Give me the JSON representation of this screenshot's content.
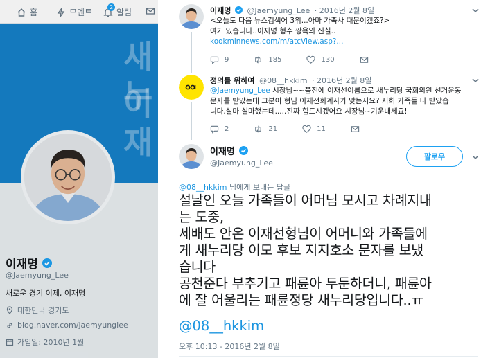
{
  "nav": {
    "home": "홈",
    "moments": "모멘트",
    "notifications": "알림",
    "notif_count": "2"
  },
  "banner": {
    "line1": "새누",
    "line2": "이재"
  },
  "profile": {
    "name": "이재명",
    "handle": "@Jaemyung_Lee",
    "bio": "새로운 경기 이제, 이재명",
    "location": "대한민국 경기도",
    "website": "blog.naver.com/jaemyunglee",
    "joined": "가입일: 2010년 1월"
  },
  "thread": [
    {
      "name": "이재명",
      "handle": "@Jaemyung_Lee",
      "time": "· 2016년 2월 8일",
      "lines": [
        "<오늘도 다음 뉴스검색어 3위...아마 가족사 때문이겠죠?>",
        "여기 있습니다..이재명 형수 쌍욕의 진실.."
      ],
      "link": "kookminnews.com/m/atcView.asp?...",
      "replies": "9",
      "retweets": "185",
      "likes": "130"
    },
    {
      "name": "정의를 위하여",
      "handle": "@08__hkkim",
      "time": "· 2016년 2월 8일",
      "mention": "@Jaemyung_Lee",
      "lines": [
        " 시장님~~쫌전에 이재선이름으로 새누리당 국회의원 선거운동",
        "문자를 받았는데 그분이 형님 이재선회계사가 맞는지요? 저희 가족들 다 받았습",
        "니다.설마 설마했는데.....진짜 힘드시겠어요 시장님~기운내세요!"
      ],
      "replies": "2",
      "retweets": "21",
      "likes": "11"
    }
  ],
  "main_tweet": {
    "name": "이재명",
    "handle": "@Jaemyung_Lee",
    "follow_label": "팔로우",
    "reply_to_mention": "@08__hkkim",
    "reply_to_suffix": " 님에게 보내는 답글",
    "text": "설날인 오늘 가족들이 어머님 모시고 차례지내\n는 도중,\n세배도 안온 이재선형님이 어머니와 가족들에\n게 새누리당 이모 후보 지지호소 문자를 보냈\n습니다\n공천준다 부추기고 패륜아 두둔하더니, 패륜아\n에 잘 어울리는 패륜정당 새누리당입니다..ㅠ",
    "mention": "@08__hkkim",
    "timestamp": "오후 10:13 - 2016년 2월 8일"
  },
  "colors": {
    "accent": "#1da1f2",
    "link": "#1b95e0",
    "muted": "#657786",
    "banner": "#1681c9"
  }
}
